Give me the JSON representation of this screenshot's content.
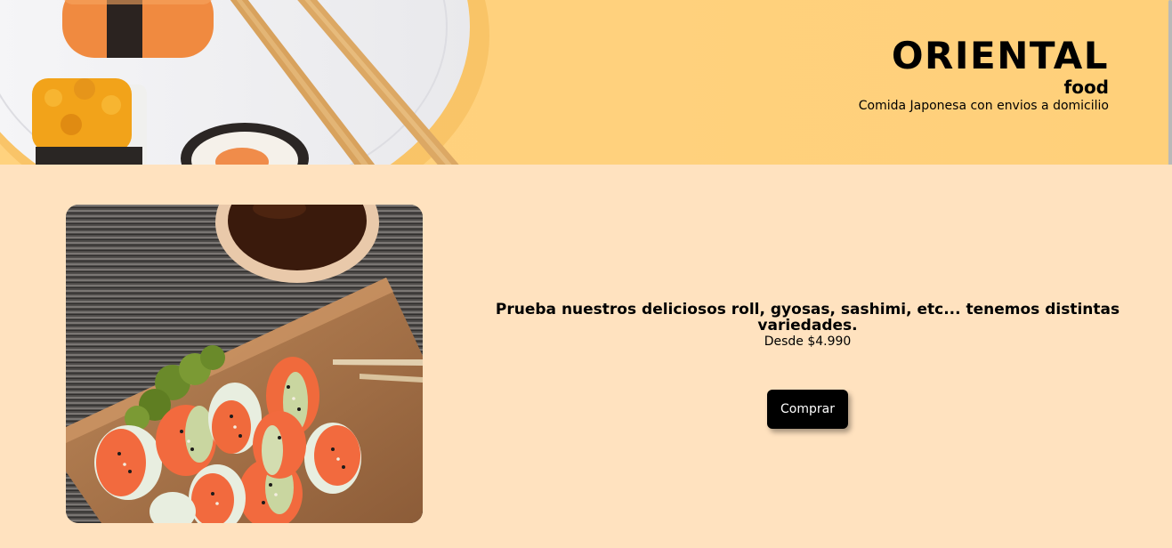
{
  "header": {
    "brand_title": "ORIENTAL",
    "brand_sub": "food",
    "tagline": "Comida Japonesa con envios a domicilio"
  },
  "product": {
    "headline": "Prueba nuestros deliciosos roll, gyosas, sashimi, etc... tenemos distintas variedades.",
    "price": "Desde $4.990",
    "buy_label": "Comprar"
  },
  "colors": {
    "header_bg": "#ffd27e",
    "page_bg": "#ffe2bf",
    "button_bg": "#000000",
    "button_text": "#ffffff"
  }
}
